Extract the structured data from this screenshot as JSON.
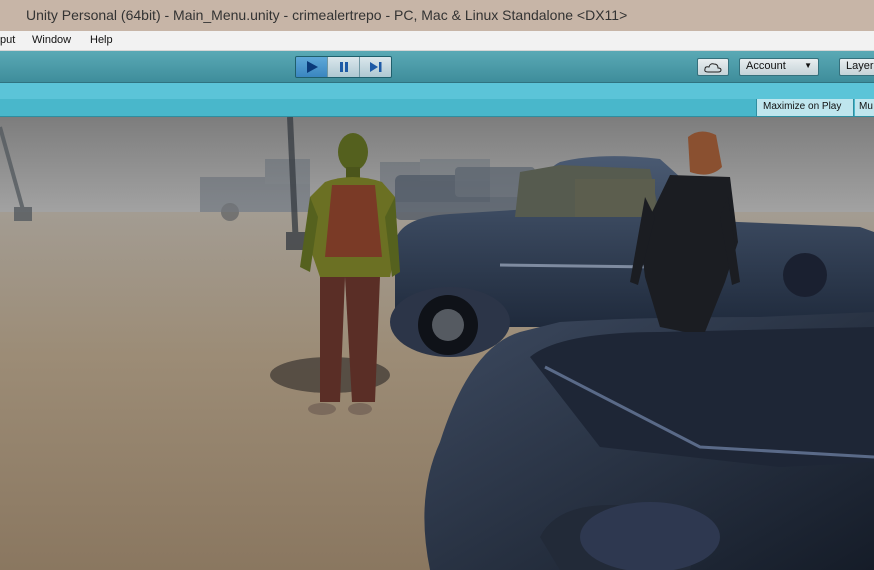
{
  "window": {
    "title": "Unity Personal (64bit) - Main_Menu.unity - crimealertrepo - PC, Mac & Linux Standalone <DX11>"
  },
  "menu": {
    "items": [
      "put",
      "Window",
      "Help"
    ]
  },
  "toolbar": {
    "play_icon": "play-icon",
    "pause_icon": "pause-icon",
    "step_icon": "step-icon",
    "cloud_icon": "cloud-icon",
    "account_label": "Account",
    "layers_label": "Layer",
    "play_active": true,
    "accent": "#4a9fd5"
  },
  "game_view": {
    "maximize_label": "Maximize on Play",
    "mute_label": "Mu"
  },
  "scene": {
    "description_icons": [
      "character-zombie",
      "character-woman",
      "vintage-truck",
      "vintage-car",
      "street-lamp"
    ],
    "colors": {
      "sky": "#8d8d8d",
      "ground": "#9a8b76",
      "car": "#2b3a52"
    }
  }
}
